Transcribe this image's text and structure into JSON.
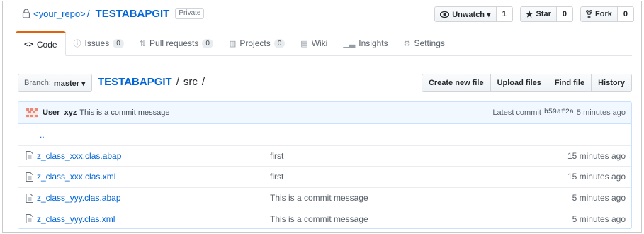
{
  "repo": {
    "owner": "<your_repo>",
    "separator": "/",
    "name": "TESTABAPGIT",
    "visibility": "Private"
  },
  "actions": {
    "watch": {
      "label": "Unwatch ▾",
      "count": "1",
      "icon": "eye-icon"
    },
    "star": {
      "label": "Star",
      "count": "0",
      "icon": "star-icon"
    },
    "fork": {
      "label": "Fork",
      "count": "0",
      "icon": "fork-icon"
    }
  },
  "tabs": [
    {
      "label": "Code",
      "icon": "code-icon",
      "selected": true
    },
    {
      "label": "Issues",
      "badge": "0",
      "icon": "issue-icon"
    },
    {
      "label": "Pull requests",
      "badge": "0",
      "icon": "pull-request-icon"
    },
    {
      "label": "Projects",
      "badge": "0",
      "icon": "project-icon"
    },
    {
      "label": "Wiki",
      "icon": "wiki-icon"
    },
    {
      "label": "Insights",
      "icon": "graph-icon"
    },
    {
      "label": "Settings",
      "icon": "gear-icon"
    }
  ],
  "branch": {
    "label": "Branch:",
    "value": "master ▾"
  },
  "breadcrumb": {
    "repo": "TESTABAPGIT",
    "sep1": "/",
    "dir": "src",
    "sep2": "/"
  },
  "file_buttons": {
    "create": "Create new file",
    "upload": "Upload files",
    "find": "Find file",
    "history": "History"
  },
  "latest_commit": {
    "author": "User_xyz",
    "message": "This is a commit message",
    "prefix": "Latest commit",
    "sha": "b59af2a",
    "age": "5 minutes ago"
  },
  "up_dir": "..",
  "files": [
    {
      "name": "z_class_xxx.clas.abap",
      "message": "first",
      "age": "15 minutes ago"
    },
    {
      "name": "z_class_xxx.clas.xml",
      "message": "first",
      "age": "15 minutes ago"
    },
    {
      "name": "z_class_yyy.clas.abap",
      "message": "This is a commit message",
      "age": "5 minutes ago"
    },
    {
      "name": "z_class_yyy.clas.xml",
      "message": "This is a commit message",
      "age": "5 minutes ago"
    }
  ],
  "colors": {
    "link": "#0366d6",
    "tab_accent": "#e36209",
    "commit_bg": "#f1f8ff"
  }
}
